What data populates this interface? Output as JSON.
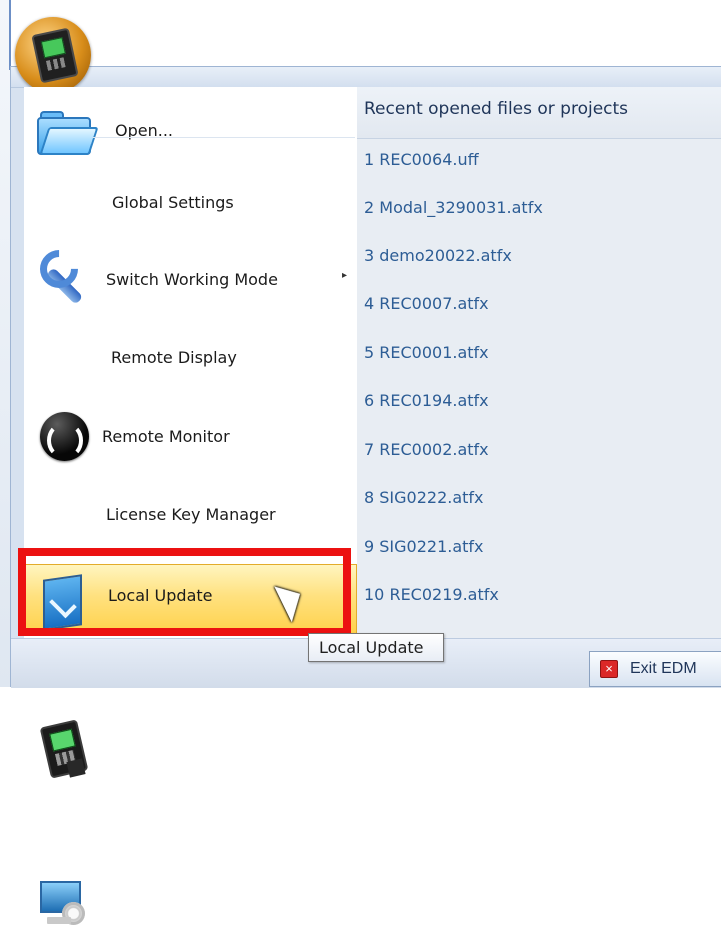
{
  "menu": {
    "items": [
      {
        "label": "Open...",
        "icon": "folder-icon"
      },
      {
        "label": "Global Settings",
        "icon": "wrench-icon"
      },
      {
        "label": "Switch Working Mode",
        "icon": "switch-icon"
      },
      {
        "label": "Remote Display",
        "icon": "remote-display-icon"
      },
      {
        "label": "Remote Monitor",
        "icon": "remote-monitor-icon"
      },
      {
        "label": "License Key Manager",
        "icon": "license-key-icon"
      },
      {
        "label": "Local Update",
        "icon": "local-update-icon"
      }
    ],
    "submenu_arrow": "▸"
  },
  "recent": {
    "title": "Recent opened files or projects",
    "files": [
      "1 REC0064.uff",
      "2 Modal_3290031.atfx",
      "3 demo20022.atfx",
      "4 REC0007.atfx",
      "5 REC0001.atfx",
      "6 REC0194.atfx",
      "7 REC0002.atfx",
      "8 SIG0222.atfx",
      "9 SIG0221.atfx",
      "10 REC0219.atfx"
    ]
  },
  "tooltip": {
    "text": "Local Update"
  },
  "footer": {
    "exit_label": "Exit EDM",
    "exit_icon": "close-icon"
  },
  "colors": {
    "highlight_red": "#ec1111",
    "selected_yellow": "#ffd14a",
    "recent_link_blue": "#2d5d95",
    "menu_background": "#d7e2f0"
  }
}
